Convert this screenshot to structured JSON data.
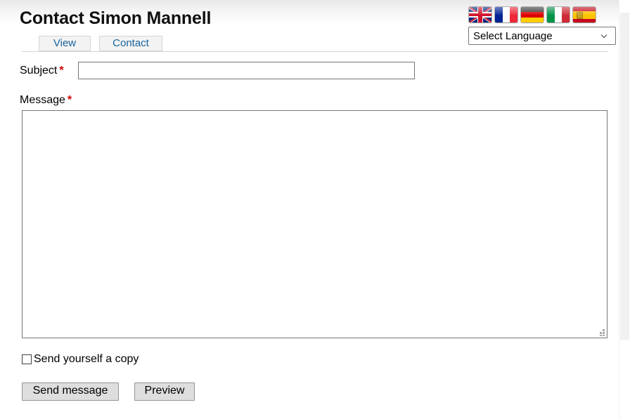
{
  "page": {
    "title": "Contact Simon Mannell"
  },
  "tabs": [
    {
      "id": "view",
      "label": "View"
    },
    {
      "id": "contact",
      "label": "Contact"
    }
  ],
  "language": {
    "select_value": "Select Language",
    "chevron_icon": "chevron-down-icon",
    "flags": [
      {
        "code": "uk",
        "name": "united-kingdom-flag-icon"
      },
      {
        "code": "fr",
        "name": "france-flag-icon"
      },
      {
        "code": "de",
        "name": "germany-flag-icon"
      },
      {
        "code": "it",
        "name": "italy-flag-icon"
      },
      {
        "code": "es",
        "name": "spain-flag-icon"
      }
    ]
  },
  "form": {
    "subject": {
      "label": "Subject",
      "required_marker": "*",
      "value": "",
      "placeholder": ""
    },
    "message": {
      "label": "Message",
      "required_marker": "*",
      "value": "",
      "placeholder": "",
      "resize_grip_icon": "resize-grip-icon"
    },
    "copy": {
      "label": "Send yourself a copy",
      "checked": false
    },
    "buttons": {
      "send": "Send message",
      "preview": "Preview"
    }
  },
  "colors": {
    "link": "#19639c",
    "required": "#d00000",
    "button_face": "#dedede",
    "border": "#767676"
  }
}
